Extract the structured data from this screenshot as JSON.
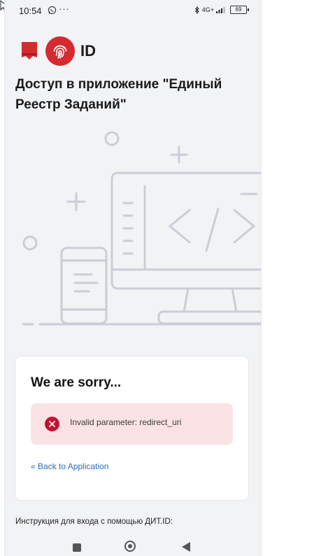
{
  "status": {
    "time": "10:54",
    "dots": "···",
    "network": "4G+",
    "battery": "69"
  },
  "logo": {
    "id_text": "ID"
  },
  "page": {
    "title": "Доступ в приложение \"Единый Реестр Заданий\""
  },
  "card": {
    "title": "We are sorry...",
    "error": "Invalid parameter: redirect_uri",
    "back_link": "« Back to Application"
  },
  "footer": {
    "instruction": "Инструкция для входа с помощью ДИТ.ID:"
  },
  "icons": {
    "bluetooth": "bluetooth-icon",
    "signal": "signal-icon",
    "whatsapp": "whatsapp-icon",
    "fingerprint": "fingerprint-icon",
    "error": "error-icon"
  },
  "colors": {
    "brand_red": "#d42a30",
    "alert_bg": "#fbe3e5",
    "error_red": "#c41230",
    "link": "#2a6fb0"
  }
}
